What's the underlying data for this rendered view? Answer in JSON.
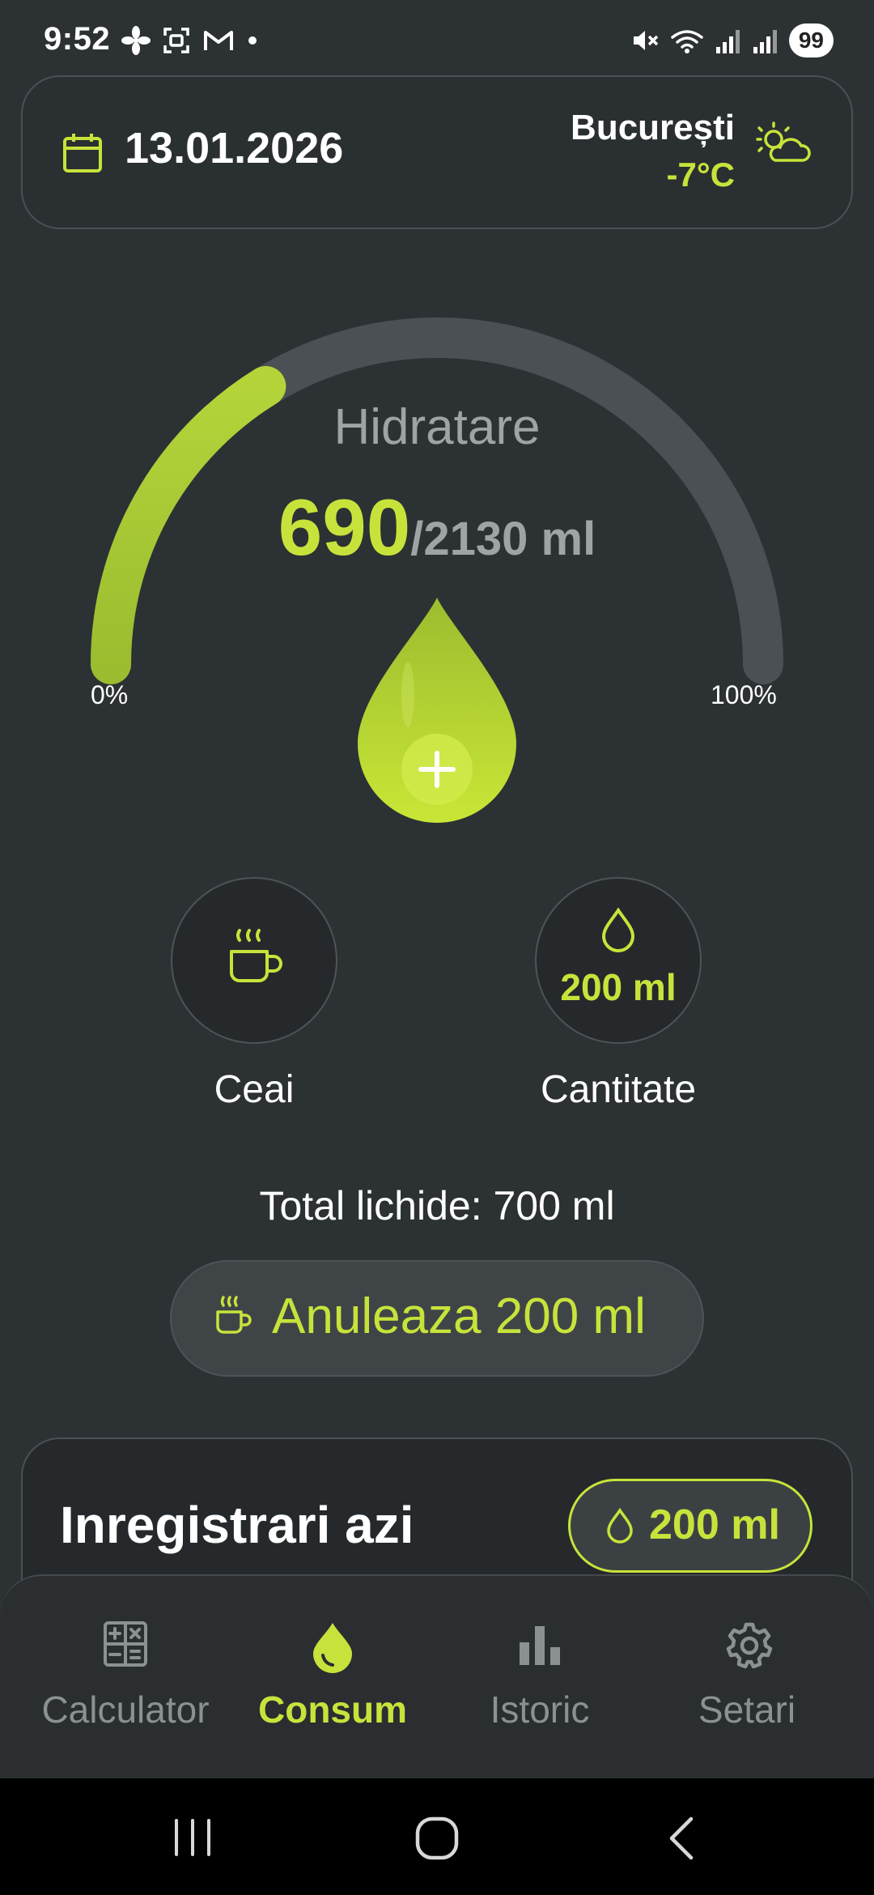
{
  "status_bar": {
    "time": "9:52",
    "battery": "99"
  },
  "header": {
    "date": "13.01.2026",
    "city": "București",
    "temperature": "-7°C"
  },
  "gauge": {
    "title": "Hidratare",
    "current_value": "690",
    "target_text": "/2130 ml",
    "progress_fraction": 0.324,
    "min_label": "0%",
    "max_label": "100%"
  },
  "selectors": {
    "drink_label": "Ceai",
    "quantity_value": "200 ml",
    "quantity_label": "Cantitate"
  },
  "total": {
    "text": "Total lichide: 700 ml"
  },
  "undo": {
    "label": "Anuleaza 200 ml"
  },
  "records": {
    "title": "Inregistrari azi",
    "pill_value": "200 ml"
  },
  "bottom_nav": {
    "items": [
      {
        "label": "Calculator",
        "icon": "calculator-icon",
        "active": false
      },
      {
        "label": "Consum",
        "icon": "drop-icon",
        "active": true
      },
      {
        "label": "Istoric",
        "icon": "bar-chart-icon",
        "active": false
      },
      {
        "label": "Setari",
        "icon": "gear-icon",
        "active": false
      }
    ]
  },
  "colors": {
    "accent": "#c7e33b",
    "background": "#2c3133",
    "muted_text": "#9ea4a6"
  }
}
